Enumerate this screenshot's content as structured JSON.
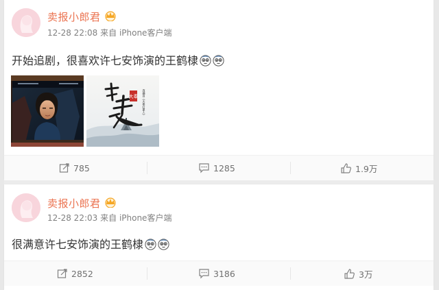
{
  "posts": [
    {
      "username": "卖报小郎君",
      "time": "12-28 22:08",
      "source_prefix": "来自",
      "source": "iPhone客户端",
      "text": "开始追剧，很喜欢许七安饰演的王鹤棣",
      "actions": {
        "repost": "785",
        "comment": "1285",
        "like": "1.9万"
      }
    },
    {
      "username": "卖报小郎君",
      "time": "12-28 22:03",
      "source_prefix": "来自",
      "source": "iPhone客户端",
      "text": "很满意许七安饰演的王鹤棣",
      "actions": {
        "repost": "2852",
        "comment": "3186",
        "like": "3万"
      }
    }
  ],
  "images": {
    "poster_title": "打更人",
    "poster_badge": "大奉",
    "poster_subtitle": "改编自《大奉打更人》"
  },
  "colors": {
    "username": "#eb7350",
    "meta": "#808080",
    "body_text": "#333333",
    "action_text": "#707070",
    "crown": "#f5a623"
  },
  "icons": [
    "avatar",
    "crown-icon",
    "emoji-icon",
    "repost-icon",
    "comment-icon",
    "like-icon"
  ]
}
